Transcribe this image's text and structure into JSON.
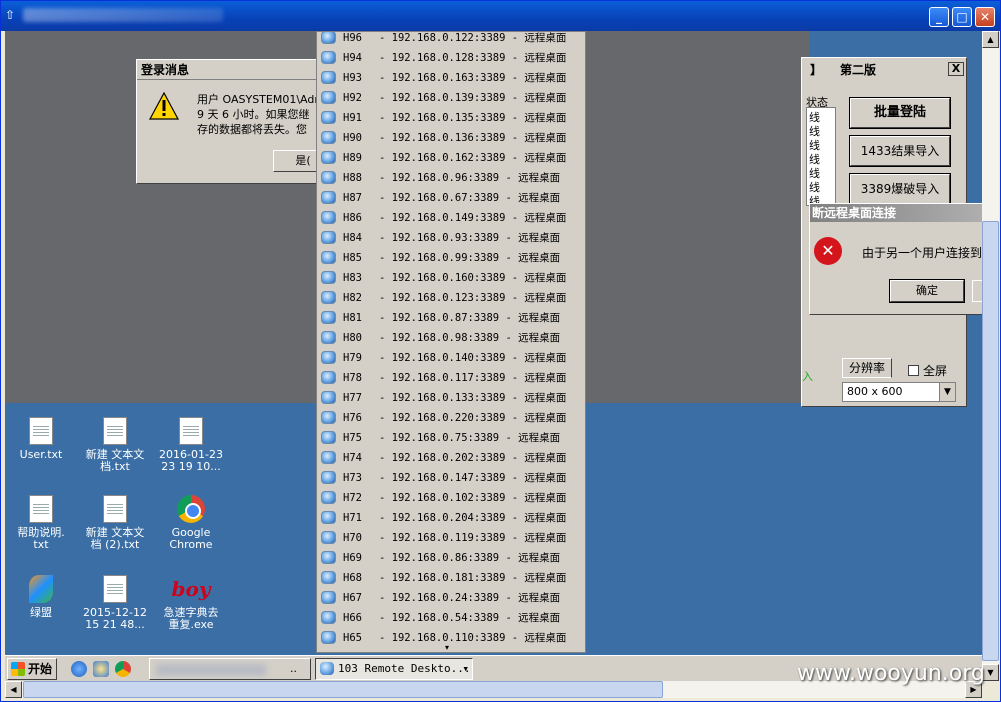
{
  "window": {
    "icons": {
      "app": "app-icon",
      "minimize": "minimize-icon",
      "maximize": "maximize-icon",
      "close": "close-icon"
    }
  },
  "login_message": {
    "title": "登录消息",
    "line1": "用户 OASYSTEM01\\Adm",
    "line2": "9 天 6 小时。如果您继",
    "line3": "存的数据都将丢失。您",
    "yes_button": "是("
  },
  "tool_panel": {
    "title_left": "】",
    "title": "第二版",
    "close": "X",
    "status_header": "状态",
    "status_rows": [
      "线",
      "线",
      "线",
      "线",
      "线",
      "线",
      "线"
    ],
    "batch_login": "批量登陆",
    "import_1433": "1433结果导入",
    "import_3389": "3389爆破导入",
    "import_partial": "入",
    "resolution_tab": "分辨率",
    "fullscreen_label": "全屏",
    "resolution_value": "800 x 600"
  },
  "error_dialog": {
    "title": "断远程桌面连接",
    "message": "由于另一个用户连接到",
    "ok_button": "确定"
  },
  "desktop_icons": [
    {
      "label1": "User.txt",
      "label2": "",
      "kind": "txt"
    },
    {
      "label1": "新建 文本文",
      "label2": "档.txt",
      "kind": "txt"
    },
    {
      "label1": "2016-01-23",
      "label2": "23 19 10...",
      "kind": "txt"
    },
    {
      "label1": "帮助说明.",
      "label2": "txt",
      "kind": "txt"
    },
    {
      "label1": "新建 文本文",
      "label2": "档 (2).txt",
      "kind": "txt"
    },
    {
      "label1": "Google",
      "label2": "Chrome",
      "kind": "chrome"
    },
    {
      "label1": "绿盟",
      "label2": "",
      "kind": "lvmeng"
    },
    {
      "label1": "2015-12-12",
      "label2": "15 21 48...",
      "kind": "txt"
    },
    {
      "label1": "急速字典去",
      "label2": "重复.exe",
      "kind": "boy"
    }
  ],
  "boy_icon_text": "boy",
  "sessions": [
    {
      "name": "H96",
      "addr": "192.168.0.122:3389",
      "type": "远程桌面"
    },
    {
      "name": "H94",
      "addr": "192.168.0.128:3389",
      "type": "远程桌面"
    },
    {
      "name": "H93",
      "addr": "192.168.0.163:3389",
      "type": "远程桌面"
    },
    {
      "name": "H92",
      "addr": "192.168.0.139:3389",
      "type": "远程桌面"
    },
    {
      "name": "H91",
      "addr": "192.168.0.135:3389",
      "type": "远程桌面"
    },
    {
      "name": "H90",
      "addr": "192.168.0.136:3389",
      "type": "远程桌面"
    },
    {
      "name": "H89",
      "addr": "192.168.0.162:3389",
      "type": "远程桌面"
    },
    {
      "name": "H88",
      "addr": "192.168.0.96:3389",
      "type": "远程桌面"
    },
    {
      "name": "H87",
      "addr": "192.168.0.67:3389",
      "type": "远程桌面"
    },
    {
      "name": "H86",
      "addr": "192.168.0.149:3389",
      "type": "远程桌面"
    },
    {
      "name": "H84",
      "addr": "192.168.0.93:3389",
      "type": "远程桌面"
    },
    {
      "name": "H85",
      "addr": "192.168.0.99:3389",
      "type": "远程桌面"
    },
    {
      "name": "H83",
      "addr": "192.168.0.160:3389",
      "type": "远程桌面"
    },
    {
      "name": "H82",
      "addr": "192.168.0.123:3389",
      "type": "远程桌面"
    },
    {
      "name": "H81",
      "addr": "192.168.0.87:3389",
      "type": "远程桌面"
    },
    {
      "name": "H80",
      "addr": "192.168.0.98:3389",
      "type": "远程桌面"
    },
    {
      "name": "H79",
      "addr": "192.168.0.140:3389",
      "type": "远程桌面"
    },
    {
      "name": "H78",
      "addr": "192.168.0.117:3389",
      "type": "远程桌面"
    },
    {
      "name": "H77",
      "addr": "192.168.0.133:3389",
      "type": "远程桌面"
    },
    {
      "name": "H76",
      "addr": "192.168.0.220:3389",
      "type": "远程桌面"
    },
    {
      "name": "H75",
      "addr": "192.168.0.75:3389",
      "type": "远程桌面"
    },
    {
      "name": "H74",
      "addr": "192.168.0.202:3389",
      "type": "远程桌面"
    },
    {
      "name": "H73",
      "addr": "192.168.0.147:3389",
      "type": "远程桌面"
    },
    {
      "name": "H72",
      "addr": "192.168.0.102:3389",
      "type": "远程桌面"
    },
    {
      "name": "H71",
      "addr": "192.168.0.204:3389",
      "type": "远程桌面"
    },
    {
      "name": "H70",
      "addr": "192.168.0.119:3389",
      "type": "远程桌面"
    },
    {
      "name": "H69",
      "addr": "192.168.0.86:3389",
      "type": "远程桌面"
    },
    {
      "name": "H68",
      "addr": "192.168.0.181:3389",
      "type": "远程桌面"
    },
    {
      "name": "H67",
      "addr": "192.168.0.24:3389",
      "type": "远程桌面"
    },
    {
      "name": "H66",
      "addr": "192.168.0.54:3389",
      "type": "远程桌面"
    },
    {
      "name": "H65",
      "addr": "192.168.0.110:3389",
      "type": "远程桌面"
    }
  ],
  "taskbar": {
    "start": "开始",
    "quick_launch": [
      "ie-icon",
      "refresh-icon",
      "chrome-icon"
    ],
    "item1_suffix": "..",
    "item2": "103 Remote Deskto...",
    "item2_arrow": "▾"
  },
  "watermark": "www.wooyun.org",
  "arrows": {
    "up": "▲",
    "down": "▼",
    "left": "◀",
    "right": "▶",
    "more": "▾"
  }
}
